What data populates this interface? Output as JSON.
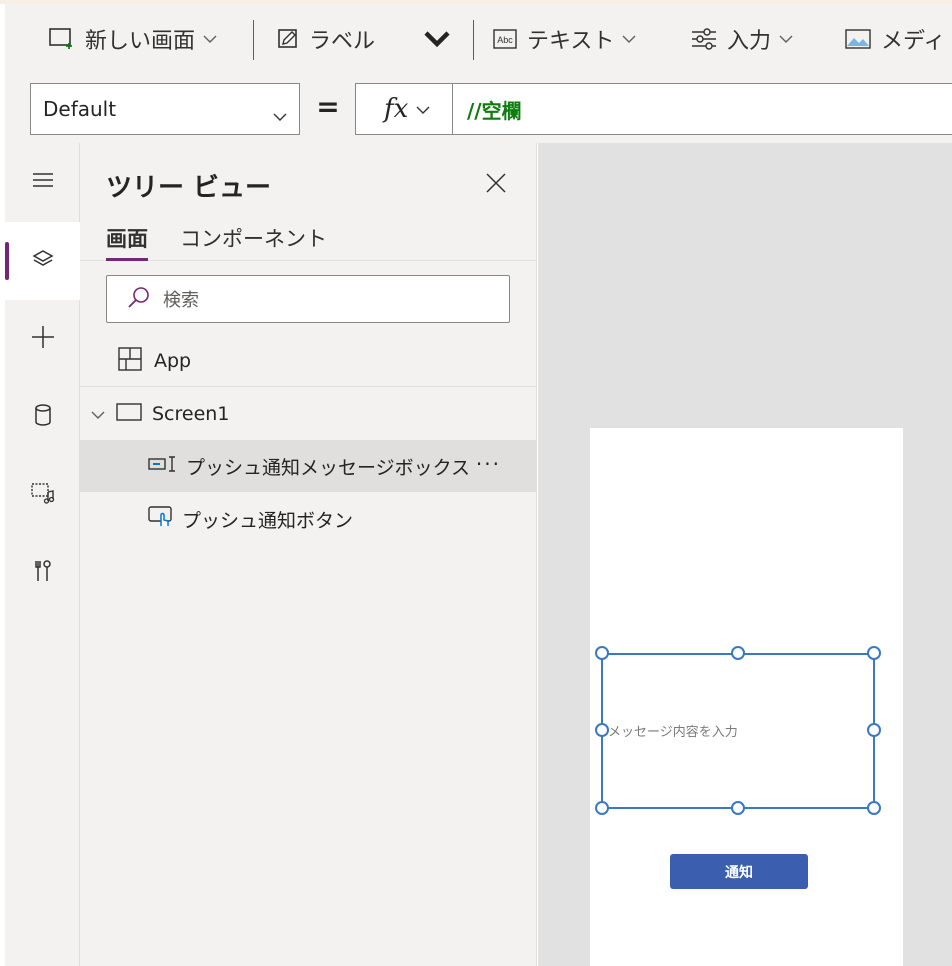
{
  "toolbar": {
    "new_screen": "新しい画面",
    "label": "ラベル",
    "text": "テキスト",
    "input": "入力",
    "media": "メディ"
  },
  "formula_bar": {
    "property": "Default",
    "equals": "=",
    "fx": "fx",
    "formula": "//空欄"
  },
  "tree_view": {
    "title": "ツリー ビュー",
    "tabs": [
      "画面",
      "コンポーネント"
    ],
    "search_placeholder": "検索",
    "app_label": "App",
    "screen_label": "Screen1",
    "items": [
      {
        "label": "プッシュ通知メッセージボックス",
        "selected": true,
        "more": "···"
      },
      {
        "label": "プッシュ通知ボタン",
        "selected": false
      }
    ]
  },
  "canvas": {
    "textbox_placeholder": "メッセージ内容を入力",
    "button_label": "通知"
  },
  "colors": {
    "accent_purple": "#742774",
    "selection_blue": "#3a78c3",
    "button_blue": "#3b5fae",
    "formula_green": "#107c10"
  }
}
